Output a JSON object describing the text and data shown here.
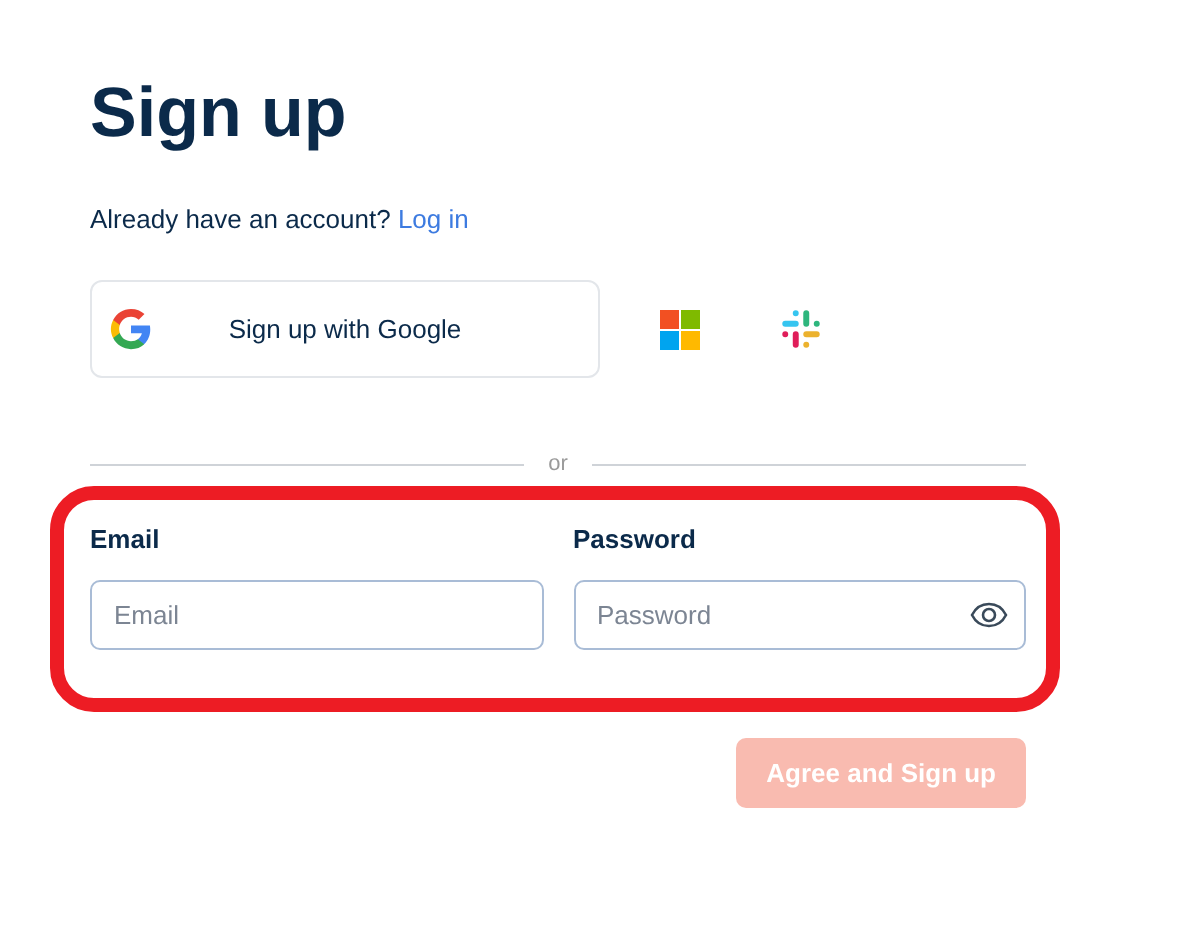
{
  "title": "Sign up",
  "login_prompt": {
    "text": "Already have an account?",
    "link": "Log in"
  },
  "social": [
    {
      "kind": "google",
      "label": "Sign up with Google"
    },
    {
      "kind": "microsoft"
    },
    {
      "kind": "slack"
    }
  ],
  "divider": "or",
  "fields": {
    "highlighted": true,
    "items": [
      {
        "kind": "email",
        "label": "Email",
        "placeholder": "Email"
      },
      {
        "kind": "password",
        "label": "Password",
        "placeholder": "Password"
      }
    ]
  },
  "submit": {
    "label": "Agree and Sign up",
    "disabled": true
  }
}
